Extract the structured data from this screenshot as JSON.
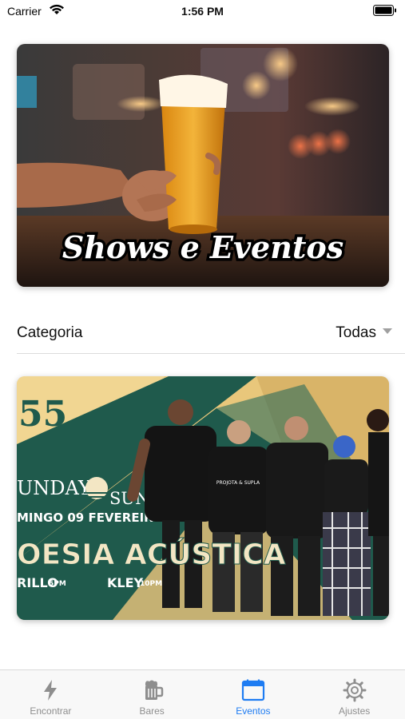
{
  "status_bar": {
    "carrier": "Carrier",
    "time": "1:56 PM"
  },
  "hero": {
    "title": "Shows e Eventos"
  },
  "filter": {
    "label": "Categoria",
    "selected": "Todas"
  },
  "event_poster": {
    "number": "55",
    "sunday": "UNDAY",
    "sunset": "SUNSET",
    "date_line": "MINGO 09 FEVEREIRO 5PM",
    "headline": "OESIA ACÚSTICA",
    "artist_left": "RILLO",
    "artist_left_time": "5PM",
    "artist_right": "KLEY",
    "artist_right_time": "10PM",
    "shirt_text": "PROJOTA & SUPLA"
  },
  "tabs": [
    {
      "label": "Encontrar",
      "icon": "lightning-icon",
      "active": false
    },
    {
      "label": "Bares",
      "icon": "beer-mug-icon",
      "active": false
    },
    {
      "label": "Eventos",
      "icon": "calendar-icon",
      "active": true
    },
    {
      "label": "Ajustes",
      "icon": "gear-icon",
      "active": false
    }
  ],
  "colors": {
    "accent": "#1e7cf2",
    "inactive": "#8e8e8e",
    "poster_green": "#1f5a4c",
    "poster_gold": "#e9c77b"
  }
}
